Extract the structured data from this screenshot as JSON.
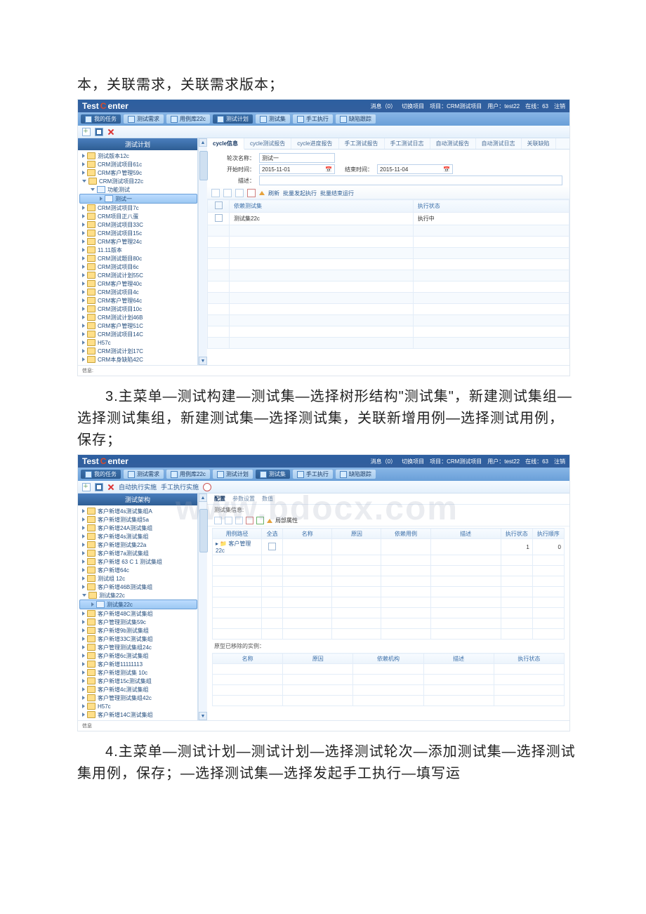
{
  "text": {
    "p0": "本，关联需求，关联需求版本；",
    "p1": "3.主菜单—测试构建—测试集—选择树形结构\"测试集\"，新建测试集组—选择测试集组，新建测试集—选择测试集，关联新增用例—选择测试用例，保存；",
    "p2": "4.主菜单—测试计划—测试计划—选择测试轮次—添加测试集—选择测试集用例，保存；—选择测试集—选择发起手工执行—填写运"
  },
  "brand": {
    "a": "Test",
    "b": "C",
    "c": "enter"
  },
  "header_right": {
    "msg": "消息（0）",
    "switch": "切换项目",
    "proj": "项目：CRM测试项目",
    "user": "用户：test22",
    "online": "在线：63",
    "logout": "注销"
  },
  "app1": {
    "menus": [
      {
        "label": "我的任务",
        "style": "dark"
      },
      {
        "label": "测试需求"
      },
      {
        "label": "用例库22c"
      },
      {
        "label": "测试计划",
        "style": "dark"
      },
      {
        "label": "测试集"
      },
      {
        "label": "手工执行"
      },
      {
        "label": "缺陷跟踪"
      }
    ],
    "sidebar_title": "测试计划",
    "tree": [
      {
        "label": "测试版本12c",
        "folder": true
      },
      {
        "label": "CRM测试项目61c",
        "folder": true
      },
      {
        "label": "CRM客户管理59c",
        "folder": true
      },
      {
        "label": "CRM测试项目22c",
        "folder": true,
        "expanded": true
      },
      {
        "label": "功能测试",
        "child": true,
        "doc": true,
        "expanded": true
      },
      {
        "label": "测试一",
        "child2": true,
        "doc": true,
        "selected": true
      },
      {
        "label": "CRM测试项目7c",
        "folder": true
      },
      {
        "label": "CRM项目正八蛋",
        "folder": true
      },
      {
        "label": "CRM测试项目33C",
        "folder": true
      },
      {
        "label": "CRM测试项目15c",
        "folder": true
      },
      {
        "label": "CRM客户管理24c",
        "folder": true
      },
      {
        "label": "11.11版本",
        "folder": true
      },
      {
        "label": "CRM测试题目80c",
        "folder": true
      },
      {
        "label": "CRM测试项目6c",
        "folder": true
      },
      {
        "label": "CRM测试计划55C",
        "folder": true
      },
      {
        "label": "CRM客户管理40c",
        "folder": true
      },
      {
        "label": "CRM测试项目4c",
        "folder": true
      },
      {
        "label": "CRM客户管理64c",
        "folder": true
      },
      {
        "label": "CRM测试项目10c",
        "folder": true
      },
      {
        "label": "CRM测试计划46B",
        "folder": true
      },
      {
        "label": "CRM客户管理51C",
        "folder": true
      },
      {
        "label": "CRM测试项目14C",
        "folder": true
      },
      {
        "label": "H57c",
        "folder": true
      },
      {
        "label": "CRM测试计划17C",
        "folder": true
      },
      {
        "label": "CRM本身缺陷42C",
        "folder": true
      }
    ],
    "tabs": [
      "cycle信息",
      "cycle测试报告",
      "cycle进度报告",
      "手工测试报告",
      "手工测试日志",
      "自动测试报告",
      "自动测试日志",
      "关联缺陷"
    ],
    "form": {
      "name_lbl": "轮次名称：",
      "name_val": "测试一",
      "start_lbl": "开始时间：",
      "start_val": "2015-11-01",
      "end_lbl": "结束时间：",
      "end_val": "2015-11-04",
      "desc_lbl": "描述："
    },
    "gridbar": [
      "刷新",
      "批量发起执行",
      "批量结束运行"
    ],
    "grid": {
      "headers_chk": "",
      "headers": [
        "依赖测试集",
        "执行状态"
      ],
      "rows": [
        {
          "col1": "测试集22c",
          "col2": "执行中"
        }
      ]
    },
    "status": "信息:"
  },
  "app2": {
    "menus": [
      {
        "label": "我的任务",
        "style": "dark"
      },
      {
        "label": "测试需求"
      },
      {
        "label": "用例库22c"
      },
      {
        "label": "测试计划"
      },
      {
        "label": "测试集",
        "style": "dark"
      },
      {
        "label": "手工执行"
      },
      {
        "label": "缺陷跟踪"
      }
    ],
    "toolbar2": [
      "自动执行实施",
      "手工执行实施"
    ],
    "sidebar_title": "测试架构",
    "tree": [
      {
        "label": "客户新增4s测试集组A",
        "folder": true
      },
      {
        "label": "客户新增测试集组5a",
        "folder": true
      },
      {
        "label": "客户新增24A测试集组",
        "folder": true
      },
      {
        "label": "客户新增4s测试集组",
        "folder": true
      },
      {
        "label": "客户新增测试集22a",
        "folder": true
      },
      {
        "label": "客户新增7a测试集组",
        "folder": true
      },
      {
        "label": "客户新增 63 C 1 测试集组",
        "folder": true
      },
      {
        "label": "客户新增64c",
        "folder": true
      },
      {
        "label": "测试组 12c",
        "folder": true
      },
      {
        "label": "客户新增46B测试集组",
        "folder": true
      },
      {
        "label": "测试集22c",
        "folder": true,
        "expanded": true
      },
      {
        "label": "测试集22c",
        "child": true,
        "doc": true,
        "selected": true
      },
      {
        "label": "客户新增48C测试集组",
        "folder": true
      },
      {
        "label": "客户管理测试集59c",
        "folder": true
      },
      {
        "label": "客户新增9b测试集组",
        "folder": true
      },
      {
        "label": "客户新增33C测试集组",
        "folder": true
      },
      {
        "label": "客户管理测试集组24c",
        "folder": true
      },
      {
        "label": "客户新增6c测试集组",
        "folder": true
      },
      {
        "label": "客户新增11111113",
        "folder": true
      },
      {
        "label": "客户新增测试集 10c",
        "folder": true
      },
      {
        "label": "客户新增15c测试集组",
        "folder": true
      },
      {
        "label": "客户新增4c测试集组",
        "folder": true
      },
      {
        "label": "客户管理测试集组42c",
        "folder": true
      },
      {
        "label": "H57c",
        "folder": true
      },
      {
        "label": "客户新增14C测试集组",
        "folder": true
      }
    ],
    "subtabs": [
      "配置",
      "参数设置",
      "数值"
    ],
    "topline": "测试集信息:",
    "inner_bar_label": "局部属性",
    "grid_top": {
      "headers": [
        "用例路径",
        "全选",
        "名称",
        "原因",
        "依赖用例",
        "描述",
        "执行状态",
        "执行顺序"
      ],
      "row_label": "客户管理22c",
      "exec": "1",
      "order": "0"
    },
    "sep_caption": "原型已移除的实例：",
    "grid_bottom": {
      "headers": [
        "名称",
        "原因",
        "依赖机构",
        "描述",
        "执行状态"
      ]
    },
    "status": "信息"
  },
  "watermark": "www.bdocx.com"
}
